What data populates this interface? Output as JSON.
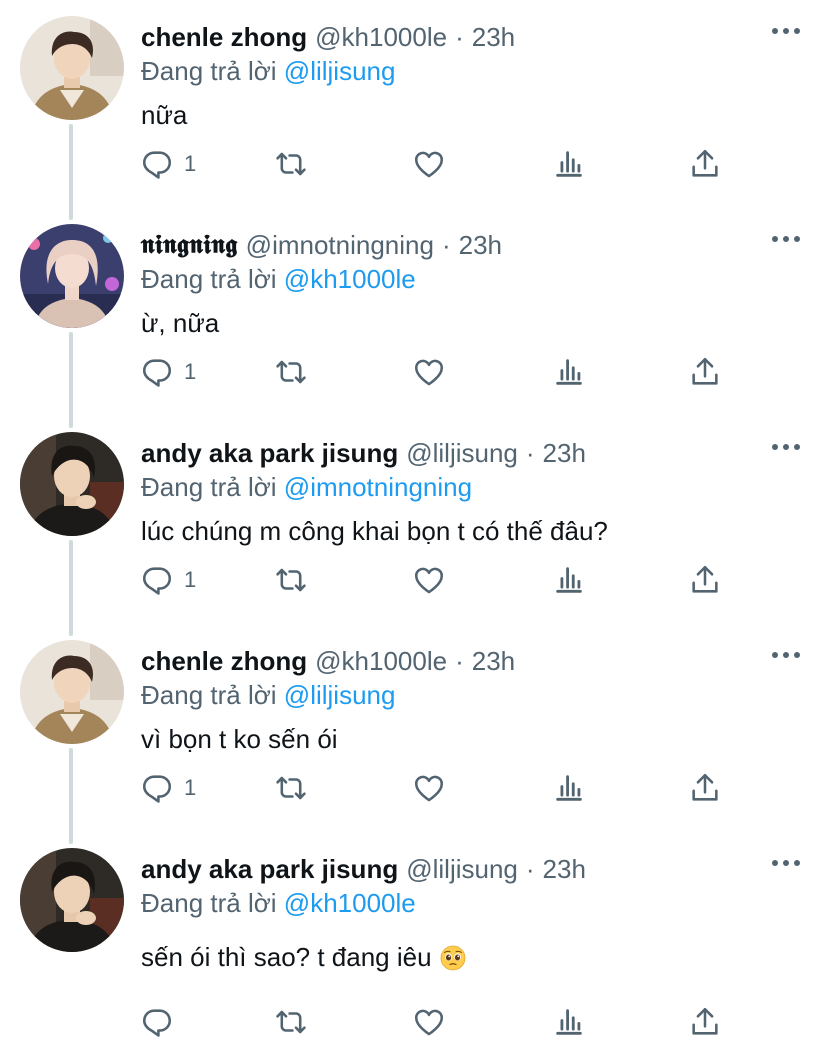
{
  "tweets": [
    {
      "name": "chenle zhong",
      "handle": "@kh1000le",
      "time": "23h",
      "reply_prefix": "Đang trả lời",
      "reply_to": "@liljisung",
      "text": "nữa",
      "reply_count": "1",
      "avatar": "avatar-chenle"
    },
    {
      "name": "𝖓𝖎𝖓𝖌𝖓𝖎𝖓𝖌",
      "handle": "@imnotningning",
      "time": "23h",
      "reply_prefix": "Đang trả lời",
      "reply_to": "@kh1000le",
      "text": "ừ, nữa",
      "reply_count": "1",
      "avatar": "avatar-ningning"
    },
    {
      "name": "andy aka park jisung",
      "handle": "@liljisung",
      "time": "23h",
      "reply_prefix": "Đang trả lời",
      "reply_to": "@imnotningning",
      "text": "lúc chúng m công khai bọn t có thế đâu?",
      "reply_count": "1",
      "avatar": "avatar-jisung"
    },
    {
      "name": "chenle zhong",
      "handle": "@kh1000le",
      "time": "23h",
      "reply_prefix": "Đang trả lời",
      "reply_to": "@liljisung",
      "text": "vì bọn t ko sến ói",
      "reply_count": "1",
      "avatar": "avatar-chenle"
    },
    {
      "name": "andy aka park jisung",
      "handle": "@liljisung",
      "time": "23h",
      "reply_prefix": "Đang trả lời",
      "reply_to": "@kh1000le",
      "text": "sến ói thì sao? t đang iêu",
      "reply_count": "",
      "avatar": "avatar-jisung",
      "emoji": "pleading-face-emoji"
    }
  ],
  "icons": {
    "reply": "reply-icon",
    "retweet": "retweet-icon",
    "like": "heart-icon",
    "views": "views-icon",
    "share": "share-icon",
    "more": "more-icon"
  },
  "colors": {
    "text": "#0f1419",
    "secondary": "#536471",
    "mention": "#1d9bf0",
    "thread_line": "#cfd9de"
  }
}
